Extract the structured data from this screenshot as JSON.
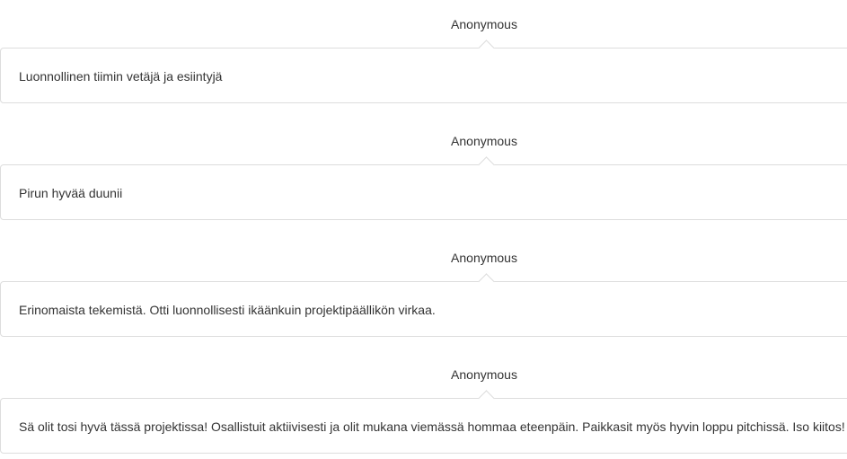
{
  "feedback": [
    {
      "author": "Anonymous",
      "text": "Luonnollinen tiimin vetäjä ja esiintyjä"
    },
    {
      "author": "Anonymous",
      "text": "Pirun hyvää duunii"
    },
    {
      "author": "Anonymous",
      "text": "Erinomaista tekemistä. Otti luonnollisesti ikäänkuin projektipäällikön virkaa."
    },
    {
      "author": "Anonymous",
      "text": "Sä olit tosi hyvä tässä projektissa! Osallistuit aktiivisesti ja olit mukana viemässä hommaa eteenpäin. Paikkasit myös hyvin loppu pitchissä. Iso kiitos!"
    }
  ],
  "colors": {
    "text": "#333333",
    "border": "#dddddd",
    "background": "#ffffff"
  }
}
